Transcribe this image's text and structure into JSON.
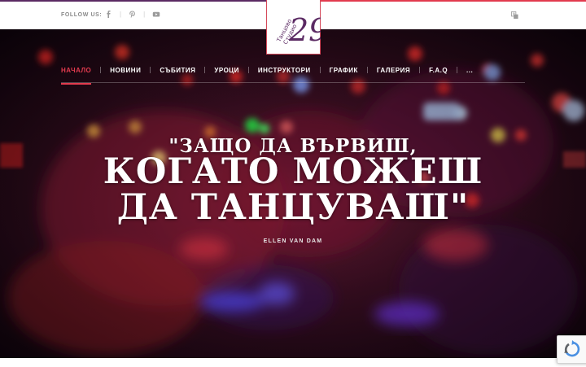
{
  "topbar": {
    "follow_label": "FOLLOW US:",
    "social": [
      {
        "icon": "facebook-icon"
      },
      {
        "icon": "pinterest-icon"
      },
      {
        "icon": "youtube-icon"
      }
    ],
    "language_icon": "translate-icon"
  },
  "logo": {
    "text_line1": "Танцово",
    "text_line2": "Студио",
    "number": "29"
  },
  "nav": {
    "items": [
      {
        "label": "НАЧАЛО",
        "active": true
      },
      {
        "label": "НОВИНИ"
      },
      {
        "label": "СЪБИТИЯ"
      },
      {
        "label": "УРОЦИ"
      },
      {
        "label": "ИНСТРУКТОРИ"
      },
      {
        "label": "ГРАФИК"
      },
      {
        "label": "ГАЛЕРИЯ"
      },
      {
        "label": "F.A.Q"
      },
      {
        "label": "..."
      }
    ]
  },
  "hero": {
    "quote_line1": "\"ЗАЩО ДА ВЪРВИШ,",
    "quote_line2": "КОГАТО МОЖЕШ",
    "quote_line3": "ДА ТАНЦУВАШ\"",
    "author": "ELLEN VAN DAM"
  },
  "colors": {
    "accent": "#e23b4e",
    "brand_purple": "#5b2a63"
  }
}
